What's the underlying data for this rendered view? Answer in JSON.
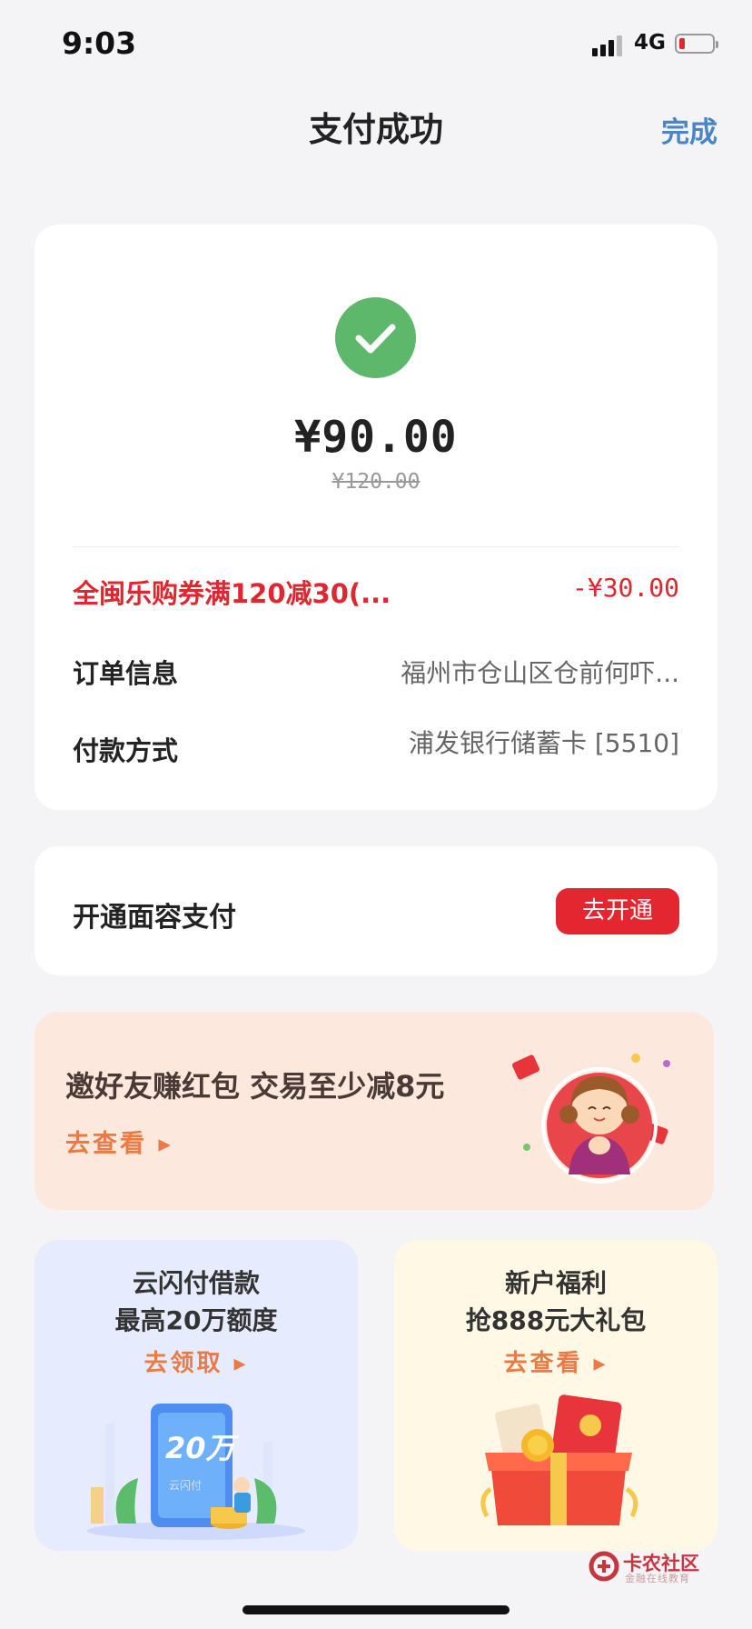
{
  "status_bar": {
    "time": "9:03",
    "network": "4G"
  },
  "nav": {
    "title": "支付成功",
    "done_label": "完成"
  },
  "payment": {
    "amount": "¥90.00",
    "original_amount": "¥120.00",
    "coupon_label": "全闽乐购券满120减30(...",
    "coupon_value": "-¥30.00",
    "order_label": "订单信息",
    "order_value": "福州市仓山区仓前何吓...",
    "method_label": "付款方式",
    "method_value": "浦发银行储蓄卡 [5510]"
  },
  "face_pay": {
    "label": "开通面容支付",
    "button_label": "去开通"
  },
  "invite": {
    "title": "邀好友赚红包 交易至少减8元",
    "link": "去查看 ▸"
  },
  "loan": {
    "line1": "云闪付借款",
    "line2": "最高20万额度",
    "link": "去领取 ▸",
    "art_text": "20万",
    "art_sub": "云闪付"
  },
  "gift": {
    "line1": "新户福利",
    "line2": "抢888元大礼包",
    "link": "去查看 ▸"
  },
  "watermark": {
    "text": "卡农社区",
    "sub": "金融在线教育"
  },
  "colors": {
    "success": "#5db86b",
    "accent_red": "#e3262f",
    "link_blue": "#4a86c5",
    "promo_orange": "#ec7a45"
  }
}
